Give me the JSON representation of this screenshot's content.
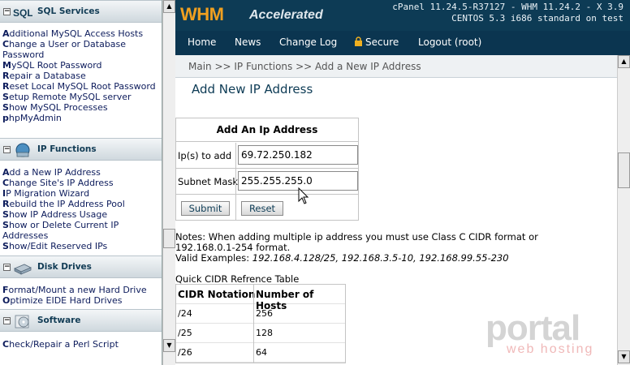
{
  "sidebar": {
    "sql": {
      "title": "SQL Services",
      "icon_text": "SQL",
      "links": [
        "Additional MySQL Access Hosts",
        "Change a User or Database Password",
        "MySQL Root Password",
        "Repair a Database",
        "Reset Local MySQL Root Password",
        "Setup Remote MySQL server",
        "Show MySQL Processes",
        "phpMyAdmin"
      ]
    },
    "ip": {
      "title": "IP Functions",
      "links": [
        "Add a New IP Address",
        "Change Site's IP Address",
        "IP Migration Wizard",
        "Rebuild the IP Address Pool",
        "Show IP Address Usage",
        "Show or Delete Current IP Addresses",
        "Show/Edit Reserved IPs"
      ]
    },
    "disk": {
      "title": "Disk Drives",
      "links": [
        "Format/Mount a new Hard Drive",
        "Optimize EIDE Hard Drives"
      ]
    },
    "software": {
      "title": "Software",
      "links": [
        "Check/Repair a Perl Script"
      ]
    },
    "toggle_symbol": "−"
  },
  "header": {
    "logo_main": "WHM",
    "logo_sub": "Accelerated",
    "version_line1": "cPanel 11.24.5-R37127 - WHM 11.24.2 - X 3.9",
    "version_line2": "CENTOS 5.3 i686 standard on test"
  },
  "nav": {
    "home": "Home",
    "news": "News",
    "changelog": "Change Log",
    "secure": "Secure",
    "logout": "Logout (root)"
  },
  "breadcrumb": "Main >> IP Functions >> Add a New IP Address",
  "page": {
    "title": "Add New IP Address",
    "form": {
      "header": "Add An Ip Address",
      "ip_label": "Ip(s) to add",
      "ip_value": "69.72.250.182",
      "mask_label": "Subnet Mask",
      "mask_value": "255.255.255.0",
      "submit": "Submit",
      "reset": "Reset"
    },
    "notes": {
      "line1": "Notes: When adding multiple ip address you must use Class C CIDR format or",
      "line2": "192.168.0.1-254 format.",
      "line3_prefix": "Valid Examples:",
      "line3_examples": "192.168.4.128/25, 192.168.3.5-10, 192.168.99.55-230"
    },
    "cidr_table": {
      "caption": "Quick CIDR Refrence Table",
      "headers": [
        "CIDR Notation",
        "Number of Hosts"
      ],
      "rows": [
        [
          "/24",
          "256"
        ],
        [
          "/25",
          "128"
        ],
        [
          "/26",
          "64"
        ]
      ]
    }
  },
  "watermark": {
    "main": "portal",
    "sub": "web hosting"
  },
  "scroll": {
    "up": "▲",
    "down": "▼"
  },
  "colors": {
    "header_bg": "#0d3b55",
    "logo_orange": "#f0a020",
    "link_blue": "#0d1c5c"
  }
}
